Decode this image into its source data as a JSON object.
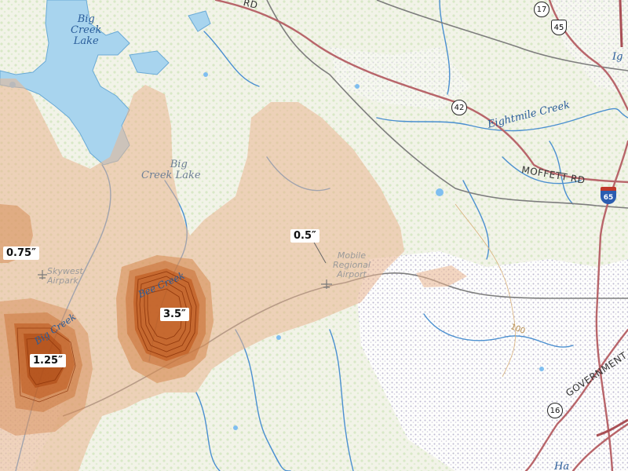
{
  "map": {
    "water_labels": {
      "big_creek_lake_north": [
        "Big",
        "Creek",
        "Lake"
      ],
      "big_creek_lake_south": [
        "Big",
        "Creek Lake"
      ],
      "eightmile_creek": "Eightmile Creek",
      "big_creek": "Big Creek",
      "bee_creek": "Bee Creek"
    },
    "place_labels": {
      "skywest_airpark": [
        "Skywest",
        "Airpark"
      ],
      "mobile_regional_airport": [
        "Mobile",
        "Regional",
        "Airport"
      ]
    },
    "road_labels": {
      "rd_top": "RD",
      "moffett_rd": "MOFFETT RD",
      "government_blvd": "GOVERNMENT BLV",
      "partial_ig": "Ig",
      "partial_ha": "Ha"
    },
    "shields": {
      "route_17": "17",
      "us_45": "45",
      "route_42": "42",
      "interstate_65": "65",
      "route_16": "16"
    },
    "contour_label": "100",
    "colors": {
      "water": "#a8d4ee",
      "water_stroke": "#6aaad6",
      "light_overlay": "#e9b48f",
      "heavy_overlay": "#b94f11",
      "major_road": "#b8656a",
      "rail": "#7d7d7d",
      "urban": "#c9c3d9"
    }
  },
  "chart_data": {
    "type": "map",
    "title": "",
    "values": [
      {
        "label": "0.75″"
      },
      {
        "label": "0.5″"
      },
      {
        "label": "3.5″"
      },
      {
        "label": "1.25″"
      }
    ]
  }
}
